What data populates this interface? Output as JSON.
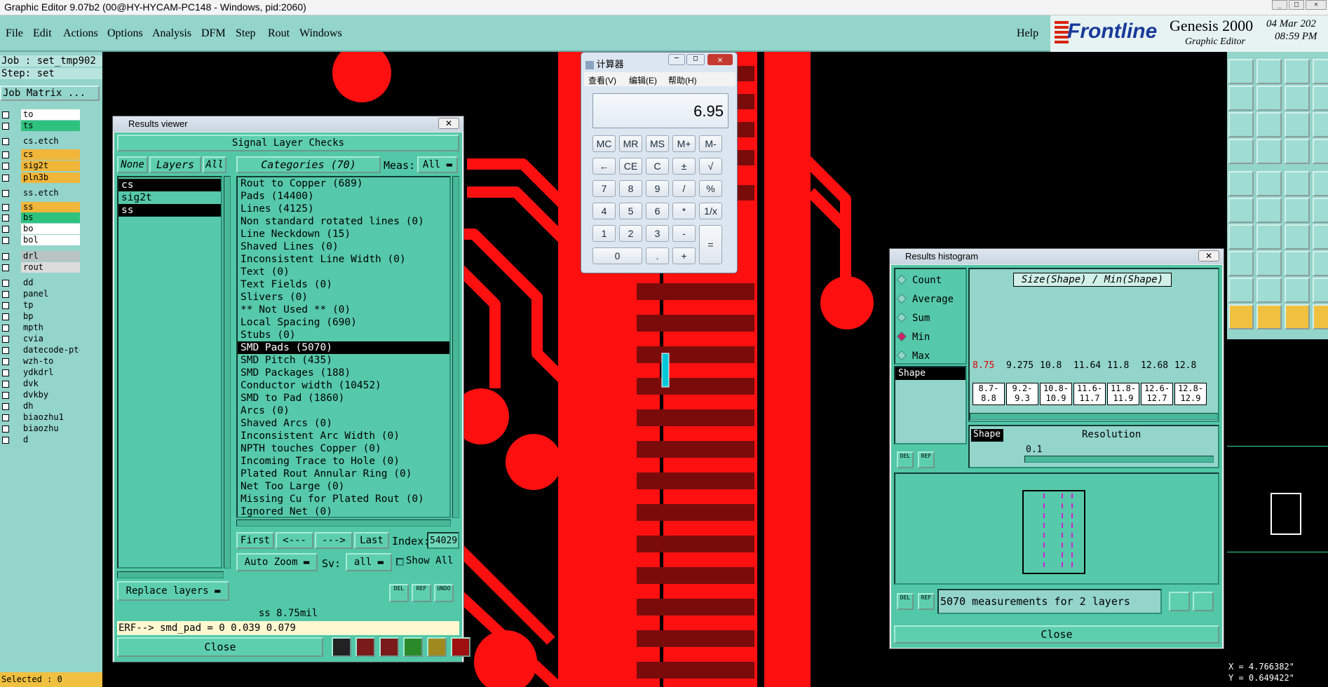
{
  "app": {
    "window_title": "Graphic Editor 9.07b2 (00@HY-HYCAM-PC148 - Windows, pid:2060)",
    "product": "Genesis 2000",
    "product_sub": "Graphic Editor",
    "brand": "Frontline",
    "date": "04 Mar 202",
    "time": "08:59 PM"
  },
  "menu": [
    "File",
    "Edit",
    "Actions",
    "Options",
    "Analysis",
    "DFM",
    "Step",
    "Rout",
    "Windows"
  ],
  "help_label": "Help",
  "job": {
    "job_label": "Job : set_tmp902",
    "step_label": "Step: set",
    "matrix_button": "Job Matrix ..."
  },
  "layers": [
    {
      "name": "to",
      "color": "#ffffff"
    },
    {
      "name": "ts",
      "color": "#2ec27e"
    },
    {
      "name": "cs.etch",
      "color": "#93d4cb"
    },
    {
      "name": "cs",
      "color": "#f0b63a"
    },
    {
      "name": "sig2t",
      "color": "#f0b63a"
    },
    {
      "name": "pln3b",
      "color": "#f0b63a"
    },
    {
      "name": "ss.etch",
      "color": "#93d4cb"
    },
    {
      "name": "ss",
      "color": "#f0b63a"
    },
    {
      "name": "bs",
      "color": "#2ec27e"
    },
    {
      "name": "bo",
      "color": "#ffffff"
    },
    {
      "name": "bol",
      "color": "#ffffff"
    },
    {
      "name": "drl",
      "color": "#b9c3c2"
    },
    {
      "name": "rout",
      "color": "#dcdcdc"
    },
    {
      "name": "dd",
      "color": "#93d4cb"
    },
    {
      "name": "panel",
      "color": "#93d4cb"
    },
    {
      "name": "tp",
      "color": "#93d4cb"
    },
    {
      "name": "bp",
      "color": "#93d4cb"
    },
    {
      "name": "mpth",
      "color": "#93d4cb"
    },
    {
      "name": "cvia",
      "color": "#93d4cb"
    },
    {
      "name": "datecode-ptc",
      "color": "#93d4cb"
    },
    {
      "name": "wzh-to",
      "color": "#93d4cb"
    },
    {
      "name": "ydkdrl",
      "color": "#93d4cb"
    },
    {
      "name": "dvk",
      "color": "#93d4cb"
    },
    {
      "name": "dvkby",
      "color": "#93d4cb"
    },
    {
      "name": "dh",
      "color": "#93d4cb"
    },
    {
      "name": "biaozhu1",
      "color": "#93d4cb"
    },
    {
      "name": "biaozhu",
      "color": "#93d4cb"
    },
    {
      "name": "d",
      "color": "#93d4cb"
    }
  ],
  "selected_label": "Selected : 0",
  "results_viewer": {
    "title": "Results viewer",
    "header": "Signal Layer Checks",
    "none_btn": "None",
    "layers_btn": "Layers",
    "all_btn": "All",
    "categories_btn": "Categories (70)",
    "meas_label": "Meas:",
    "meas_value": "All",
    "layer_list": [
      "cs",
      "sig2t",
      "ss"
    ],
    "categories": [
      "Rout to Copper (689)",
      "Pads (14400)",
      "Lines (4125)",
      "Non standard rotated lines (0)",
      "Line Neckdown (15)",
      "Shaved Lines (0)",
      "Inconsistent Line Width (0)",
      "Text (0)",
      "Text Fields (0)",
      "Slivers (0)",
      "** Not Used ** (0)",
      "Local Spacing (690)",
      "Stubs (0)",
      "SMD Pads (5070)",
      "SMD Pitch (435)",
      "SMD Packages (188)",
      "Conductor width (10452)",
      "SMD to Pad (1860)",
      "Arcs (0)",
      "Shaved Arcs (0)",
      "Inconsistent Arc Width (0)",
      "NPTH touches Copper (0)",
      "Incoming Trace to Hole (0)",
      "Plated Rout Annular Ring (0)",
      "Net Too Large (0)",
      "Missing Cu for Plated Rout (0)",
      "Ignored Net (0)"
    ],
    "first_btn": "First",
    "prev_btn": "<---",
    "next_btn": "--->",
    "last_btn": "Last",
    "index_label": "Index:",
    "index_value": "54029",
    "replace_layers": "Replace layers",
    "auto_zoom": "Auto Zoom",
    "sv_label": "Sv:",
    "sv_value": "all",
    "show_all": "Show All",
    "status": "ss 8.75mil",
    "erf": "ERF--> smd_pad = 0 0.039 0.079",
    "close": "Close"
  },
  "calculator": {
    "title": "计算器",
    "menu": [
      "查看(V)",
      "编辑(E)",
      "帮助(H)"
    ],
    "display": "6.95",
    "keys": [
      [
        "MC",
        "MR",
        "MS",
        "M+",
        "M-"
      ],
      [
        "←",
        "CE",
        "C",
        "±",
        "√"
      ],
      [
        "7",
        "8",
        "9",
        "/",
        "%"
      ],
      [
        "4",
        "5",
        "6",
        "*",
        "1/x"
      ],
      [
        "1",
        "2",
        "3",
        "-",
        "="
      ],
      [
        "0",
        ".",
        "+"
      ]
    ]
  },
  "histogram": {
    "title": "Results histogram",
    "options": [
      "Count",
      "Average",
      "Sum",
      "Min",
      "Max"
    ],
    "selected_option": "Min",
    "chart_title": "Size(Shape) / Min(Shape)",
    "shape_label": "Shape",
    "values": [
      "8.75",
      "9.275",
      "10.8",
      "11.64",
      "11.8",
      "12.68",
      "12.8"
    ],
    "ranges": [
      [
        "8.7-",
        "8.8"
      ],
      [
        "9.2-",
        "9.3"
      ],
      [
        "10.8-",
        "10.9"
      ],
      [
        "11.6-",
        "11.7"
      ],
      [
        "11.8-",
        "11.9"
      ],
      [
        "12.6-",
        "12.7"
      ],
      [
        "12.8-",
        "12.9"
      ]
    ],
    "resolution_label": "Resolution",
    "resolution_value": "0.1",
    "summary": "5070 measurements for 2 layers",
    "close": "Close",
    "del_label": "DEL",
    "ref_label": "REF"
  },
  "coords": {
    "x": "X = 4.766382\"",
    "y": "Y = 0.649422\""
  }
}
